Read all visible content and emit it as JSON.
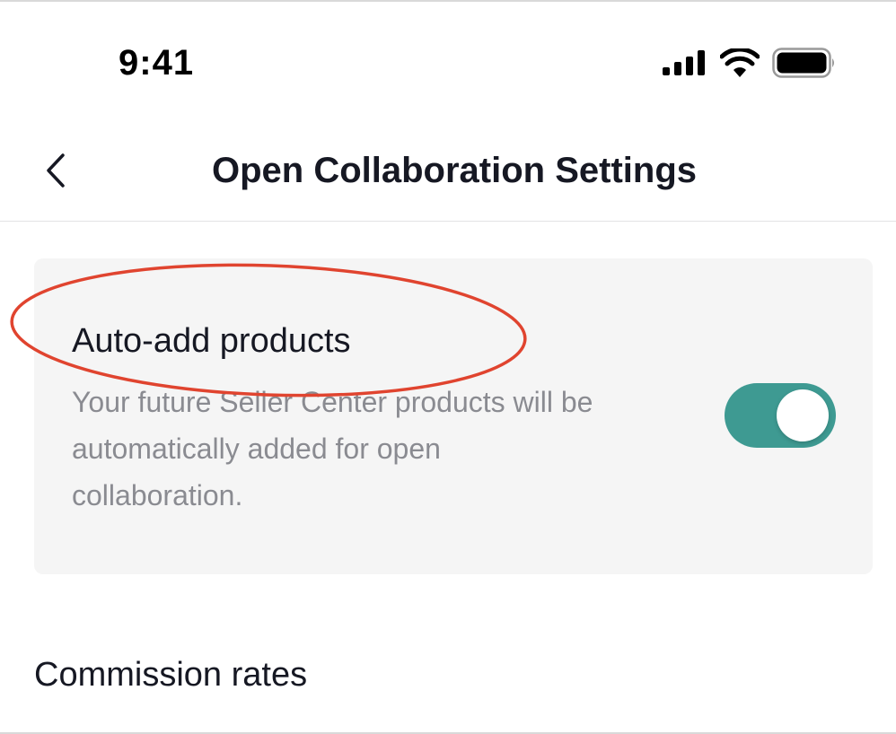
{
  "status_bar": {
    "time": "9:41",
    "icons": [
      "cellular-signal-icon",
      "wifi-icon",
      "battery-icon"
    ]
  },
  "header": {
    "back_icon": "chevron-left-icon",
    "title": "Open Collaboration Settings"
  },
  "auto_add": {
    "title": "Auto-add products",
    "description": "Your future Seller Center products will be automatically added for open collaboration.",
    "toggle_on": true,
    "toggle_color": "#3e9a92"
  },
  "annotation": {
    "shape": "ellipse",
    "color": "#e0442f"
  },
  "commission": {
    "title": "Commission rates"
  }
}
